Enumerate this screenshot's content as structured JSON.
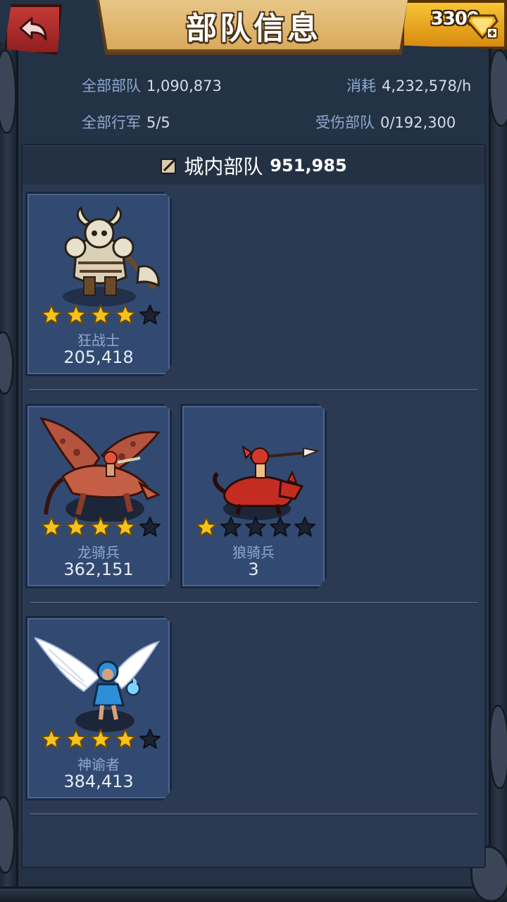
{
  "header": {
    "title": "部队信息",
    "gems": "3300"
  },
  "stats": {
    "all_troops_label": "全部部队",
    "all_troops_value": "1,090,873",
    "consumption_label": "消耗",
    "consumption_value": "4,232,578/h",
    "marches_label": "全部行军",
    "marches_value": "5/5",
    "wounded_label": "受伤部队",
    "wounded_value": "0/192,300"
  },
  "section": {
    "name": "城内部队",
    "count": "951,985"
  },
  "units": [
    {
      "name": "狂战士",
      "count": "205,418",
      "stars_filled": 4,
      "stars_total": 5,
      "icon": "berserker-portrait"
    },
    {
      "name": "龙骑兵",
      "count": "362,151",
      "stars_filled": 4,
      "stars_total": 5,
      "icon": "dragon-rider-portrait"
    },
    {
      "name": "狼骑兵",
      "count": "3",
      "stars_filled": 1,
      "stars_total": 5,
      "icon": "wolf-rider-portrait"
    },
    {
      "name": "神谕者",
      "count": "384,413",
      "stars_filled": 4,
      "stars_total": 5,
      "icon": "oracle-portrait"
    }
  ],
  "colors": {
    "background": "#243245",
    "panel": "#2b3a52",
    "card": "#324a72",
    "label": "#8ea9d0",
    "star_filled": "#f6c21c",
    "star_empty": "#1c2230"
  }
}
